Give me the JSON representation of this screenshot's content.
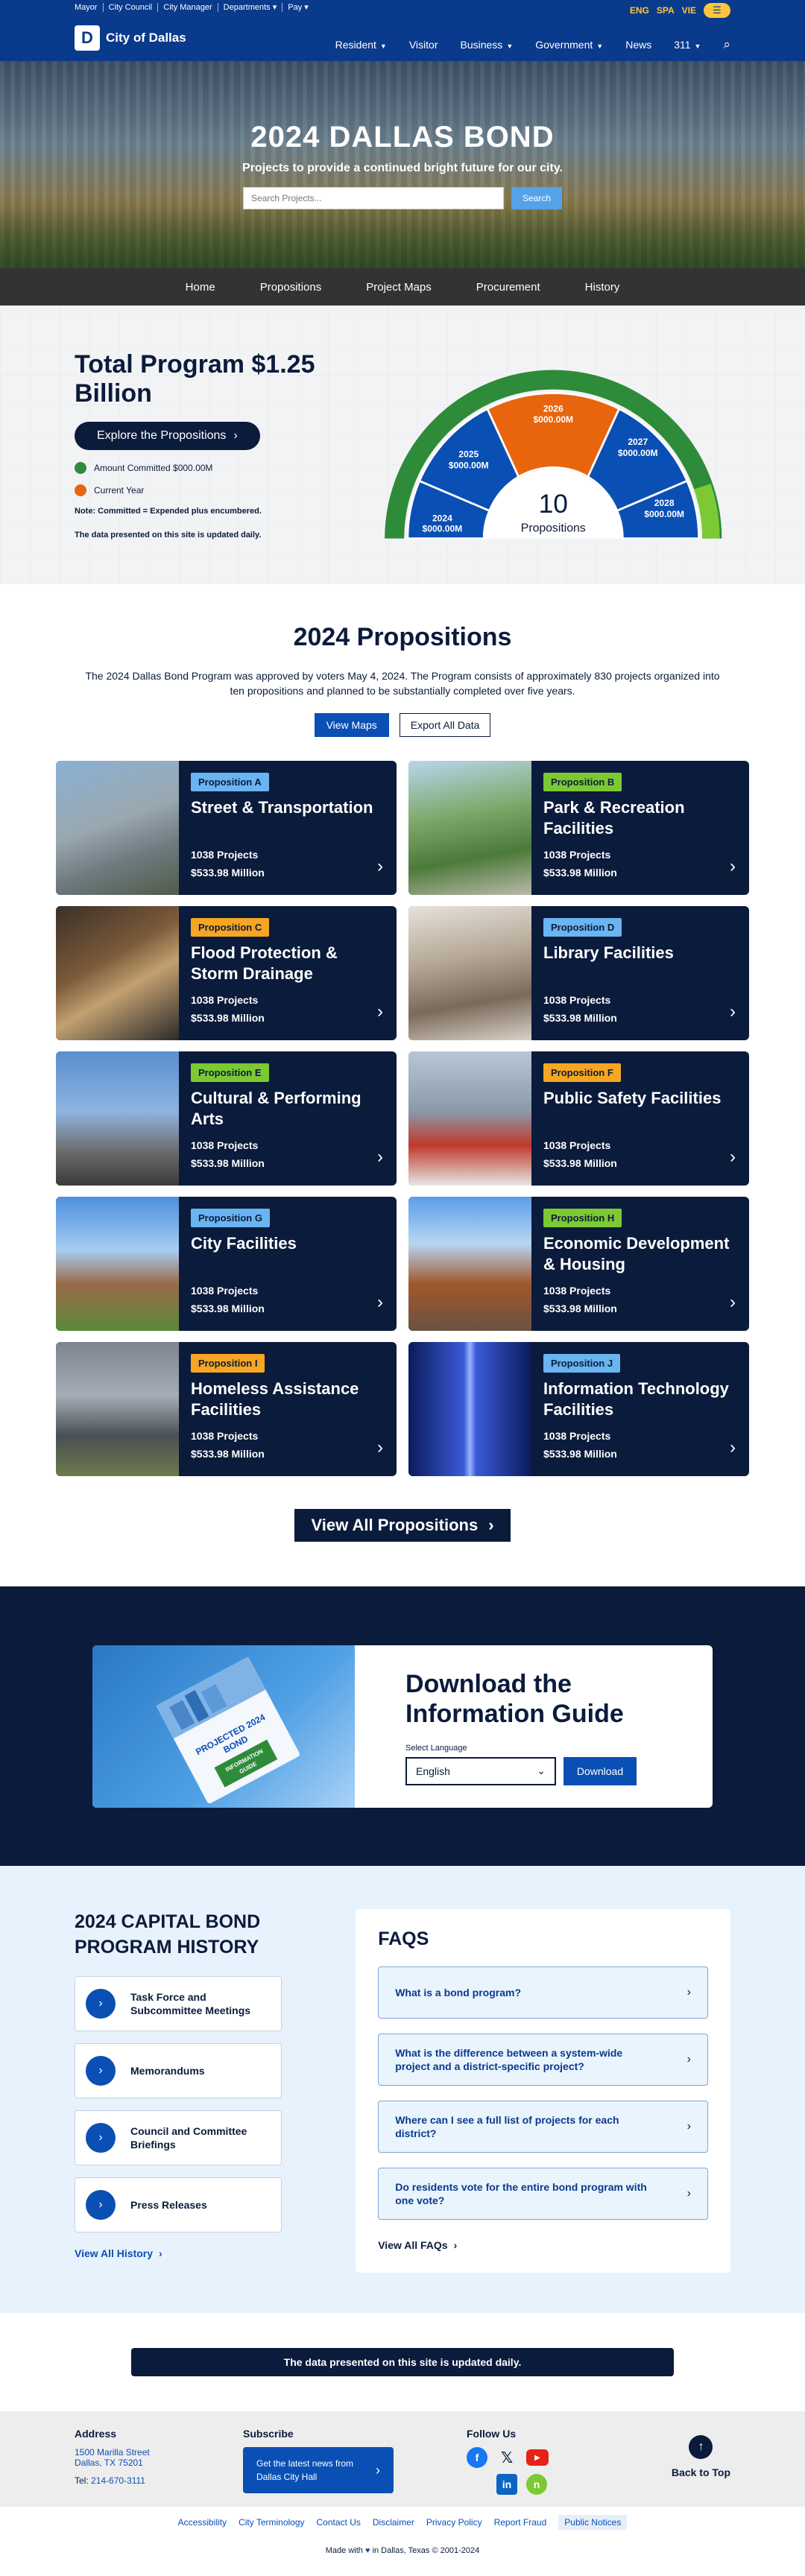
{
  "utility_bar": {
    "links": [
      "Mayor",
      "City Council",
      "City Manager",
      "Departments ▾",
      "Pay ▾"
    ]
  },
  "header": {
    "logo_text": "City of Dallas",
    "languages": [
      "ENG",
      "SPA",
      "VIE"
    ],
    "nav": [
      {
        "label": "Resident",
        "caret": true
      },
      {
        "label": "Visitor",
        "caret": false
      },
      {
        "label": "Business",
        "caret": true
      },
      {
        "label": "Government",
        "caret": true
      },
      {
        "label": "News",
        "caret": false
      },
      {
        "label": "311",
        "caret": true
      }
    ]
  },
  "hero": {
    "title": "2024 DALLAS BOND",
    "subtitle": "Projects to provide a continued bright future for our city.",
    "search_placeholder": "Search Projects...",
    "search_button": "Search"
  },
  "subnav": [
    "Home",
    "Propositions",
    "Project Maps",
    "Procurement",
    "History"
  ],
  "program": {
    "title": "Total Program $1.25 Billion",
    "button": "Explore the Propositions",
    "legend": [
      {
        "label": "Amount Committed $000.00M",
        "color": "#2e8b3a"
      },
      {
        "label": "Current Year",
        "color": "#e8650e"
      }
    ],
    "note": "Note: Committed = Expended plus encumbered.",
    "update_note": "The data presented on this site is updated daily.",
    "gauge": {
      "center_number": "10",
      "center_label": "Propositions",
      "segments": [
        {
          "year": "2024",
          "amount": "$000.00M",
          "color": "#0a4fb4"
        },
        {
          "year": "2025",
          "amount": "$000.00M",
          "color": "#0a4fb4"
        },
        {
          "year": "2026",
          "amount": "$000.00M",
          "color": "#e8650e"
        },
        {
          "year": "2027",
          "amount": "$000.00M",
          "color": "#0a4fb4"
        },
        {
          "year": "2028",
          "amount": "$000.00M",
          "color": "#0a4fb4"
        }
      ]
    }
  },
  "propositions": {
    "title": "2024 Propositions",
    "description": "The 2024 Dallas Bond Program was approved by voters May 4, 2024. The Program consists of approximately 830 projects organized into ten propositions and planned to be substantially completed over five years.",
    "view_maps": "View Maps",
    "export": "Export All Data",
    "cards": [
      {
        "badge": "Proposition A",
        "badge_color": "blue",
        "title": "Street & Transportation",
        "projects": "1038 Projects",
        "amount": "$533.98 Million"
      },
      {
        "badge": "Proposition B",
        "badge_color": "green",
        "title": "Park & Recreation Facilities",
        "projects": "1038 Projects",
        "amount": "$533.98 Million"
      },
      {
        "badge": "Proposition C",
        "badge_color": "orange",
        "title": "Flood Protection & Storm Drainage",
        "projects": "1038 Projects",
        "amount": "$533.98 Million"
      },
      {
        "badge": "Proposition D",
        "badge_color": "blue",
        "title": "Library Facilities",
        "projects": "1038 Projects",
        "amount": "$533.98 Million"
      },
      {
        "badge": "Proposition E",
        "badge_color": "green",
        "title": "Cultural & Performing Arts",
        "projects": "1038 Projects",
        "amount": "$533.98 Million"
      },
      {
        "badge": "Proposition F",
        "badge_color": "orange",
        "title": "Public Safety Facilities",
        "projects": "1038 Projects",
        "amount": "$533.98 Million"
      },
      {
        "badge": "Proposition G",
        "badge_color": "blue",
        "title": "City Facilities",
        "projects": "1038 Projects",
        "amount": "$533.98 Million"
      },
      {
        "badge": "Proposition H",
        "badge_color": "green",
        "title": "Economic Development & Housing",
        "projects": "1038 Projects",
        "amount": "$533.98 Million"
      },
      {
        "badge": "Proposition I",
        "badge_color": "orange",
        "title": "Homeless Assistance Facilities",
        "projects": "1038 Projects",
        "amount": "$533.98 Million"
      },
      {
        "badge": "Proposition J",
        "badge_color": "blue",
        "title": "Information Technology Facilities",
        "projects": "1038 Projects",
        "amount": "$533.98 Million"
      }
    ],
    "view_all": "View All Propositions"
  },
  "guide": {
    "title": "Download the Information Guide",
    "select_label": "Select Language",
    "selected_language": "English",
    "download_button": "Download",
    "brochure_text": "PROJECTED 2024 BOND INFORMATION GUIDE"
  },
  "history": {
    "title": "2024 CAPITAL BOND PROGRAM HISTORY",
    "items": [
      "Task Force and Subcommittee Meetings",
      "Memorandums",
      "Council and Committee Briefings",
      "Press Releases"
    ],
    "view_all": "View All History"
  },
  "faq": {
    "title": "FAQS",
    "items": [
      "What is a bond program?",
      "What is the difference between a system-wide project and a district-specific project?",
      "Where can I see a full list of projects for each district?",
      "Do residents vote for the entire bond program with one vote?"
    ],
    "view_all": "View All FAQs"
  },
  "notice": "The data presented on this site is updated daily.",
  "footer": {
    "address_title": "Address",
    "address_line1": "1500 Marilla Street",
    "address_line2": "Dallas, TX 75201",
    "tel_label": "Tel:",
    "tel": "214-670-3111",
    "subscribe_title": "Subscribe",
    "subscribe_button": "Get the latest news from Dallas City Hall",
    "follow_title": "Follow Us",
    "back_to_top": "Back to Top",
    "links": [
      "Accessibility",
      "City Terminology",
      "Contact Us",
      "Disclaimer",
      "Privacy Policy",
      "Report Fraud",
      "Public Notices"
    ],
    "made_with_prefix": "Made with",
    "made_with_suffix": "in Dallas, Texas © 2001-2024"
  }
}
